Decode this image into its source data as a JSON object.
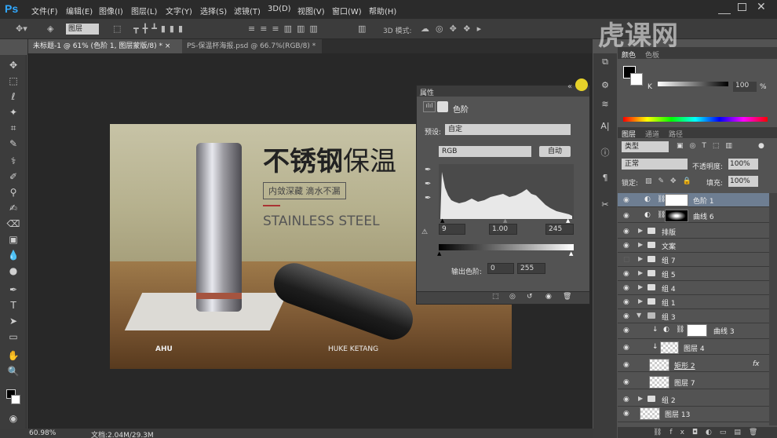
{
  "app": {
    "logo": "Ps"
  },
  "menu": [
    "文件(F)",
    "编辑(E)",
    "图像(I)",
    "图层(L)",
    "文字(Y)",
    "选择(S)",
    "滤镜(T)",
    "3D(D)",
    "视图(V)",
    "窗口(W)",
    "帮助(H)"
  ],
  "options": {
    "sample_select": "图层",
    "mode_label": "3D 模式:"
  },
  "tabs": [
    "未标题-1 @ 61% (色阶 1, 图层蒙版/8) * ×",
    "PS-保温杯海报.psd @ 66.7%(RGB/8) * ×"
  ],
  "document": {
    "title_bold": "不锈钢",
    "title_rest": "保温",
    "subtitle": "内敛深藏 滴水不漏",
    "english": "STAINLESS STEEL",
    "brand_left": "AHU",
    "brand_right": "HUKE KETANG"
  },
  "properties": {
    "tab": "属性",
    "title": "色阶",
    "preset_label": "预设:",
    "preset_value": "自定",
    "channel": "RGB",
    "auto_button": "自动",
    "input_black": "9",
    "input_gamma": "1.00",
    "input_white": "245",
    "output_label": "输出色阶:",
    "output_black": "0",
    "output_white": "255"
  },
  "color_panel": {
    "tab_color": "颜色",
    "tab_swatches": "色板",
    "channel_label": "K",
    "value": "100",
    "unit": "%"
  },
  "layers_panel": {
    "tabs": [
      "图层",
      "通道",
      "路径"
    ],
    "kind": "类型",
    "blend": "正常",
    "opacity_label": "不透明度:",
    "opacity": "100%",
    "lock_label": "锁定:",
    "fill_label": "填充:",
    "fill": "100%",
    "layers": [
      {
        "name": "色阶 1",
        "type": "adjust",
        "selected": true
      },
      {
        "name": "曲线 6",
        "type": "adjust"
      },
      {
        "name": "排版",
        "type": "group"
      },
      {
        "name": "文案",
        "type": "group"
      },
      {
        "name": "组 7",
        "type": "group",
        "hidden": true
      },
      {
        "name": "组 5",
        "type": "group"
      },
      {
        "name": "组 4",
        "type": "group"
      },
      {
        "name": "组 1",
        "type": "group"
      },
      {
        "name": "组 3",
        "type": "group-open"
      },
      {
        "name": "曲线 3",
        "type": "adjust-child"
      },
      {
        "name": "图层 4",
        "type": "pixel-child"
      },
      {
        "name": "矩形 2",
        "type": "shape",
        "fx": "fx"
      },
      {
        "name": "图层 7",
        "type": "pixel"
      },
      {
        "name": "组 2",
        "type": "group"
      },
      {
        "name": "图层 13",
        "type": "pixel"
      }
    ]
  },
  "status": {
    "zoom": "60.98%",
    "doc": "文档:2.04M/29.3M"
  },
  "watermark": "虎课网"
}
